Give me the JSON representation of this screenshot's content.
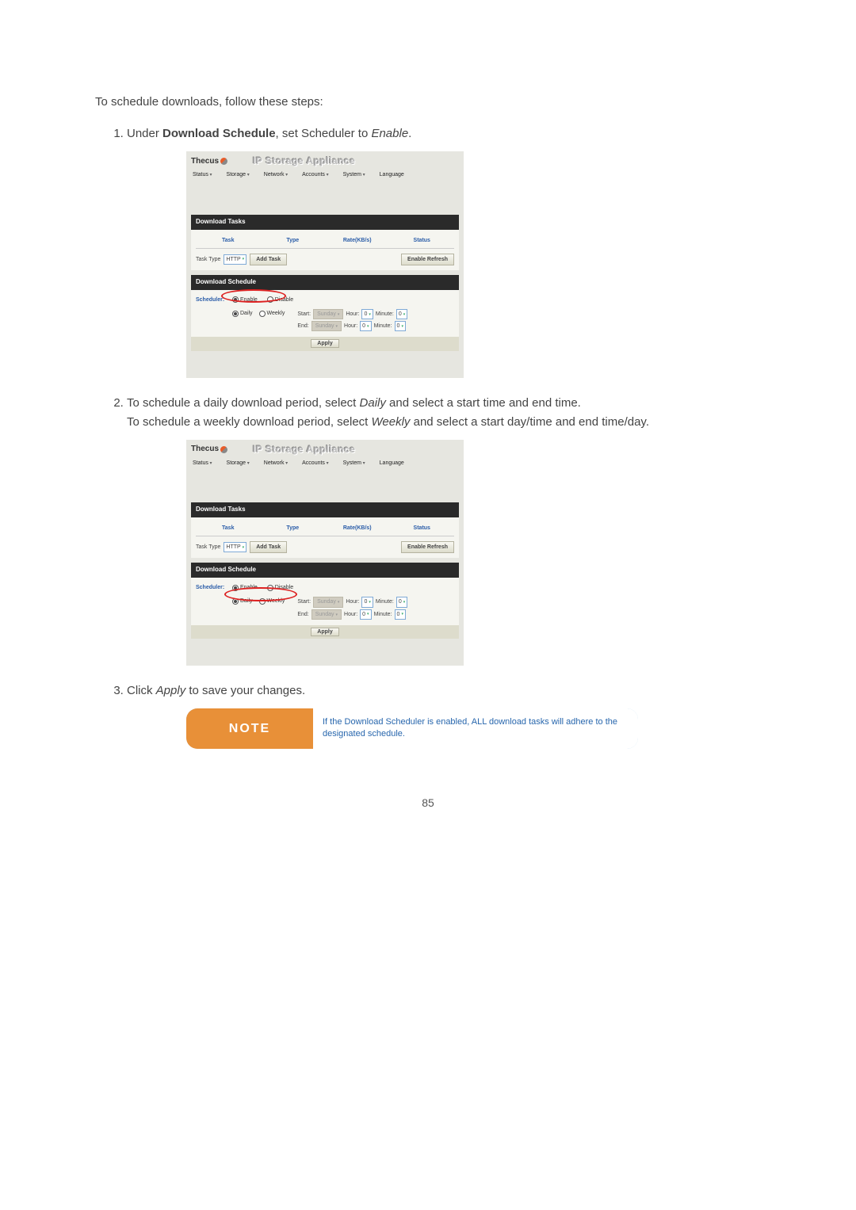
{
  "intro": "To schedule downloads, follow these steps:",
  "steps": {
    "s1_a": "Under ",
    "s1_b": "Download Schedule",
    "s1_c": ", set Scheduler to ",
    "s1_d": "Enable",
    "s1_e": ".",
    "s2_a": "To schedule a daily download period, select ",
    "s2_b": "Daily",
    "s2_c": " and select a start time and end time.",
    "s2_d": "To schedule a weekly download period, select ",
    "s2_e": "Weekly",
    "s2_f": " and select a start day/time and end time/day.",
    "s3_a": "Click ",
    "s3_b": "Apply",
    "s3_c": " to save your changes."
  },
  "note": {
    "label": "NOTE",
    "text": "If the Download Scheduler is enabled, ALL download tasks will adhere to the designated schedule."
  },
  "page_number": "85",
  "ss": {
    "logo": "Thecus",
    "title": "IP Storage Appliance",
    "menu": [
      "Status",
      "Storage",
      "Network",
      "Accounts",
      "System",
      "Language"
    ],
    "panel1": "Download Tasks",
    "cols": [
      "Task",
      "Type",
      "Rate(KB/s)",
      "Status"
    ],
    "task_type_label": "Task Type",
    "task_type_value": "HTTP",
    "add_task": "Add Task",
    "enable_refresh": "Enable Refresh",
    "panel2": "Download Schedule",
    "scheduler_label": "Scheduler:",
    "enable": "Enable",
    "disable": "Disable",
    "daily": "Daily",
    "weekly": "Weekly",
    "start": "Start:",
    "end": "End:",
    "day": "Sunday",
    "hour": "Hour:",
    "minute": "Minute:",
    "zero": "0",
    "apply": "Apply"
  }
}
